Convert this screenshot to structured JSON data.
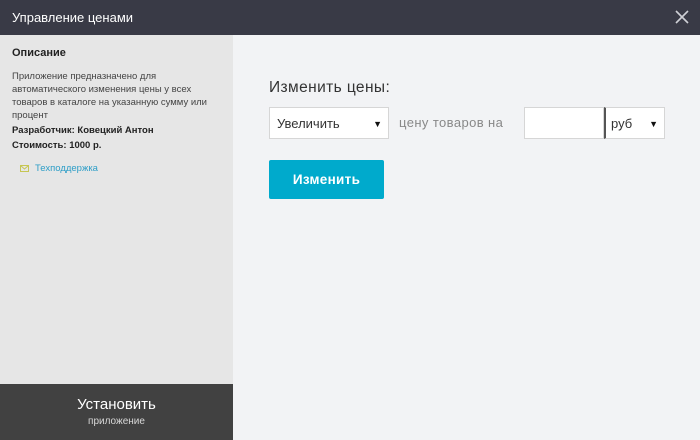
{
  "window": {
    "title": "Управление ценами",
    "close_icon": "close-icon"
  },
  "sidebar": {
    "heading": "Описание",
    "description": "Приложение предназначено для автоматического изменения цены у всех товаров в каталоге на указанную сумму или процент",
    "developer": "Разработчик: Ковецкий Антон",
    "price": "Стоимость: 1000 р.",
    "support": {
      "icon": "mail-icon",
      "label": "Техподдержка"
    }
  },
  "install": {
    "label": "Установить",
    "sublabel": "приложение"
  },
  "form": {
    "heading": "Изменить цены:",
    "action_value": "Увеличить",
    "between_text": "цену товаров на",
    "amount_value": "",
    "amount_placeholder": "",
    "unit_value": "руб",
    "dropdown_arrow": "▼",
    "submit_label": "Изменить"
  },
  "colors": {
    "titlebar": "#393a46",
    "sidebar": "#e6e6e6",
    "install": "#414141",
    "accent": "#00aacc",
    "link": "#2e9ec7",
    "content": "#f2f3f5"
  }
}
